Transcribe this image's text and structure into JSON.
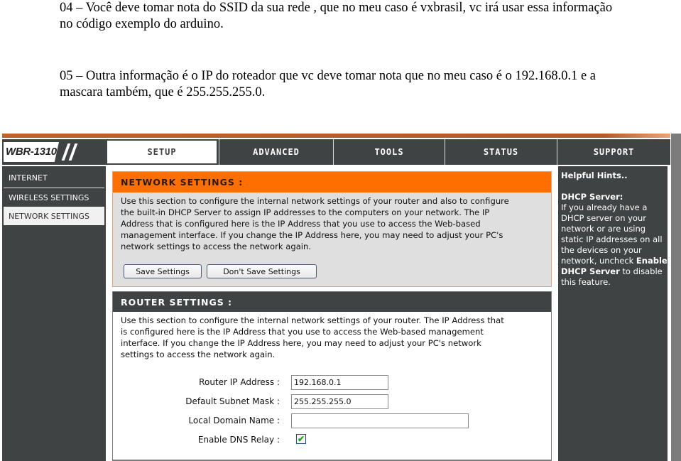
{
  "document": {
    "paragraph_04": "04 – Você deve tomar nota do SSID da sua rede , que no meu caso é vxbrasil, vc irá usar essa informação no código exemplo do arduino.",
    "paragraph_05": "05 – Outra informação é o IP do roteador que vc deve tomar nota que no meu caso é o 192.168.0.1 e a mascara  também, que é 255.255.255.0."
  },
  "router": {
    "model": "WBR-1310",
    "colors": {
      "orange": "#ff6f00",
      "dark": "#404343",
      "panel_gray": "#dfdfdf"
    },
    "tabs": [
      {
        "label": "SETUP",
        "active": true
      },
      {
        "label": "ADVANCED",
        "active": false
      },
      {
        "label": "TOOLS",
        "active": false
      },
      {
        "label": "STATUS",
        "active": false
      },
      {
        "label": "SUPPORT",
        "active": false
      }
    ],
    "sidebar": [
      {
        "label": "INTERNET",
        "active": false
      },
      {
        "label": "WIRELESS SETTINGS",
        "active": false
      },
      {
        "label": "NETWORK SETTINGS",
        "active": true
      }
    ],
    "network_settings": {
      "title": "NETWORK SETTINGS :",
      "description": "Use this section to configure the internal network settings of your router and also to configure\nthe built-in DHCP Server to assign IP addresses to the computers on your network. The IP\nAddress that is configured here is the IP Address that you use to access the Web-based\nmanagement interface. If you change the IP Address here, you may need to adjust your PC's\nnetwork settings to access the network again.",
      "save_label": "Save Settings",
      "dont_save_label": "Don't Save Settings"
    },
    "router_settings": {
      "title": "ROUTER SETTINGS :",
      "description": "Use this section to configure the internal network settings of your router. The IP Address that\nis configured here is the IP Address that you use to access the Web-based management\ninterface. If you change the IP Address here, you may need to adjust your PC's network\nsettings to access the network again.",
      "fields": {
        "router_ip_label": "Router IP Address :",
        "router_ip_value": "192.168.0.1",
        "subnet_label": "Default Subnet Mask :",
        "subnet_value": "255.255.255.0",
        "domain_label": "Local Domain Name :",
        "domain_value": "",
        "dns_relay_label": "Enable DNS Relay :",
        "dns_relay_checked": true,
        "check_glyph": "✔"
      }
    },
    "hints": {
      "title": "Helpful Hints..",
      "subtitle": "DHCP Server:",
      "text_before": "If you already have a DHCP server on your network or are using static IP addresses on all the devices on your network, uncheck ",
      "bold_text": "Enable DHCP Server",
      "text_after": " to disable this feature."
    }
  }
}
